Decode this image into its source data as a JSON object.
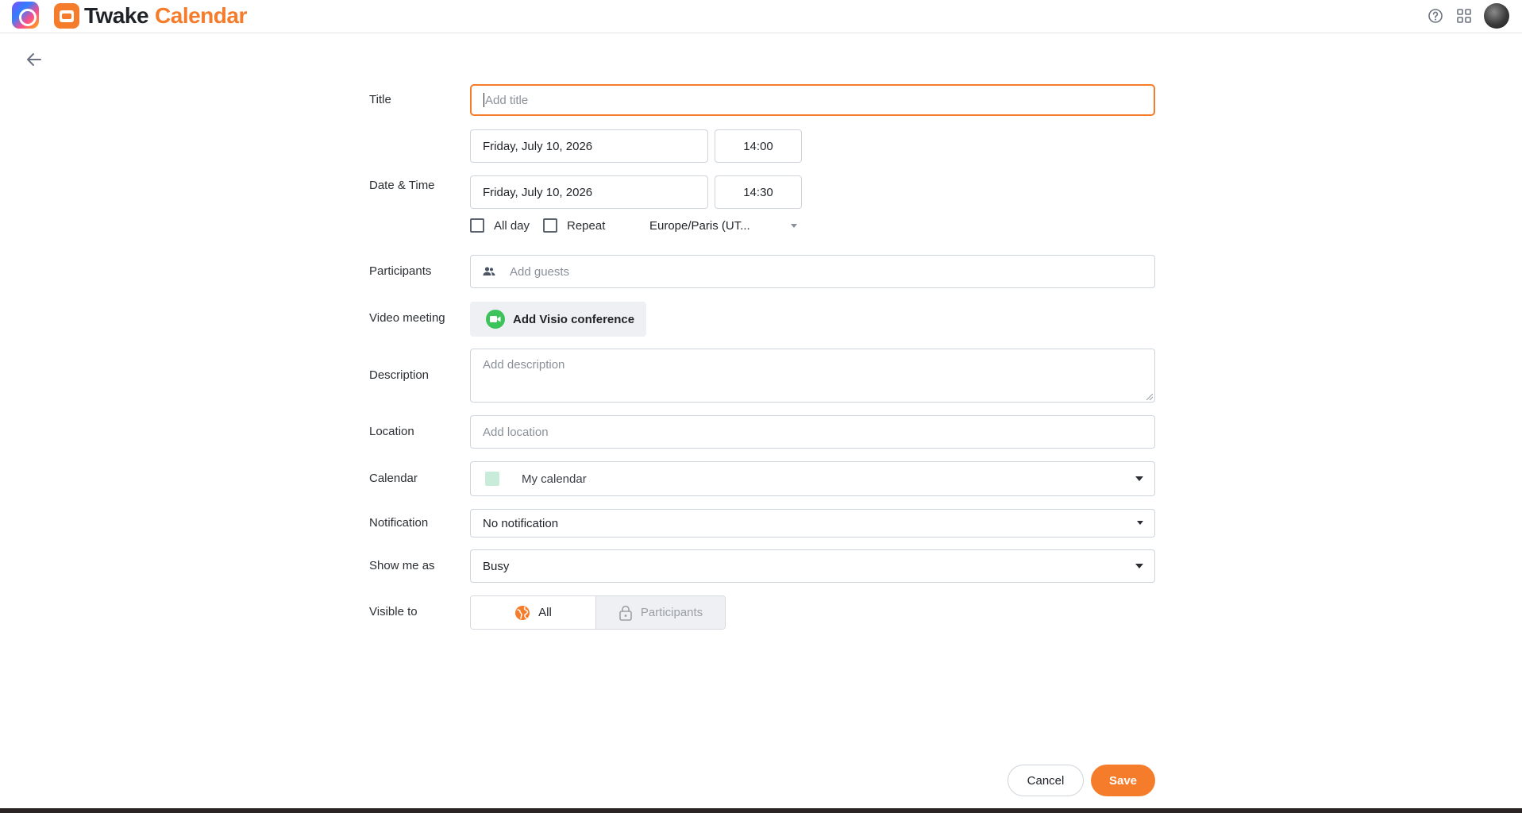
{
  "header": {
    "app_brand_part1": "Twake",
    "app_brand_part2": "Calendar",
    "icons": [
      "apps-launcher-logo",
      "calendar-logo-icon",
      "help-icon",
      "grid-apps-icon",
      "user-avatar"
    ]
  },
  "form": {
    "title_label": "Title",
    "title_placeholder": "Add title",
    "datetime_label": "Date & Time",
    "start_date": "Friday, July 10, 2026",
    "start_time": "14:00",
    "end_date": "Friday, July 10, 2026",
    "end_time": "14:30",
    "allday_label": "All day",
    "repeat_label": "Repeat",
    "timezone": "Europe/Paris (UT...",
    "participants_label": "Participants",
    "participants_placeholder": "Add guests",
    "video_label": "Video meeting",
    "video_button": "Add Visio conference",
    "description_label": "Description",
    "description_placeholder": "Add description",
    "location_label": "Location",
    "location_placeholder": "Add location",
    "calendar_label": "Calendar",
    "calendar_value": "My calendar",
    "calendar_color": "#c8ecd9",
    "notification_label": "Notification",
    "notification_value": "No notification",
    "showme_label": "Show me as",
    "showme_value": "Busy",
    "visible_label": "Visible to",
    "visible_all": "All",
    "visible_participants": "Participants"
  },
  "actions": {
    "cancel": "Cancel",
    "save": "Save"
  },
  "colors": {
    "accent": "#f47c2b",
    "visio_green": "#3cc35b"
  }
}
